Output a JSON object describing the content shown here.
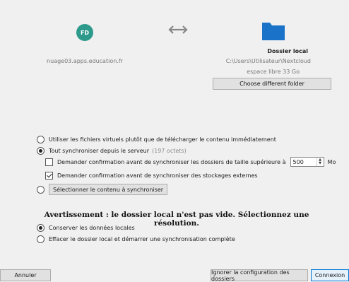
{
  "header": {
    "avatar_initials": "FD",
    "server_url": "nuage03.apps.education.fr",
    "folder_title": "Dossier local",
    "folder_path": "C:\\Users\\Utilisateur\\Nextcloud",
    "free_space": "espace libre 33 Go",
    "choose_folder_label": "Choose different folder",
    "icons": {
      "sync": "bidirectional-arrow-icon",
      "folder": "folder-icon"
    },
    "colors": {
      "avatar": "#2e9a8c",
      "folder": "#1a73c8"
    }
  },
  "sync_options": {
    "virtual_files_label": "Utiliser les fichiers virtuels plutôt que de télécharger le contenu immédiatement",
    "sync_all_label": "Tout synchroniser depuis le serveur",
    "sync_all_size": "(197 octets)",
    "confirm_large_label": "Demander confirmation avant de synchroniser les dossiers de taille supérieure à",
    "confirm_large_value": "500",
    "confirm_large_unit": "Mo",
    "confirm_external_label": "Demander confirmation avant de synchroniser des stockages externes",
    "select_content_label": "Sélectionner le contenu à synchroniser",
    "selected": "sync_all",
    "confirm_large_checked": false,
    "confirm_external_checked": true
  },
  "warning": {
    "text": "Avertissement : le dossier local n'est pas vide. Sélectionnez une résolution.",
    "keep_label": "Conserver les données locales",
    "erase_label": "Effacer le dossier local et démarrer une synchronisation complète",
    "selected": "keep"
  },
  "footer": {
    "cancel_label": "Annuler",
    "skip_label": "Ignorer la configuration des dossiers",
    "connect_label": "Connexion"
  }
}
